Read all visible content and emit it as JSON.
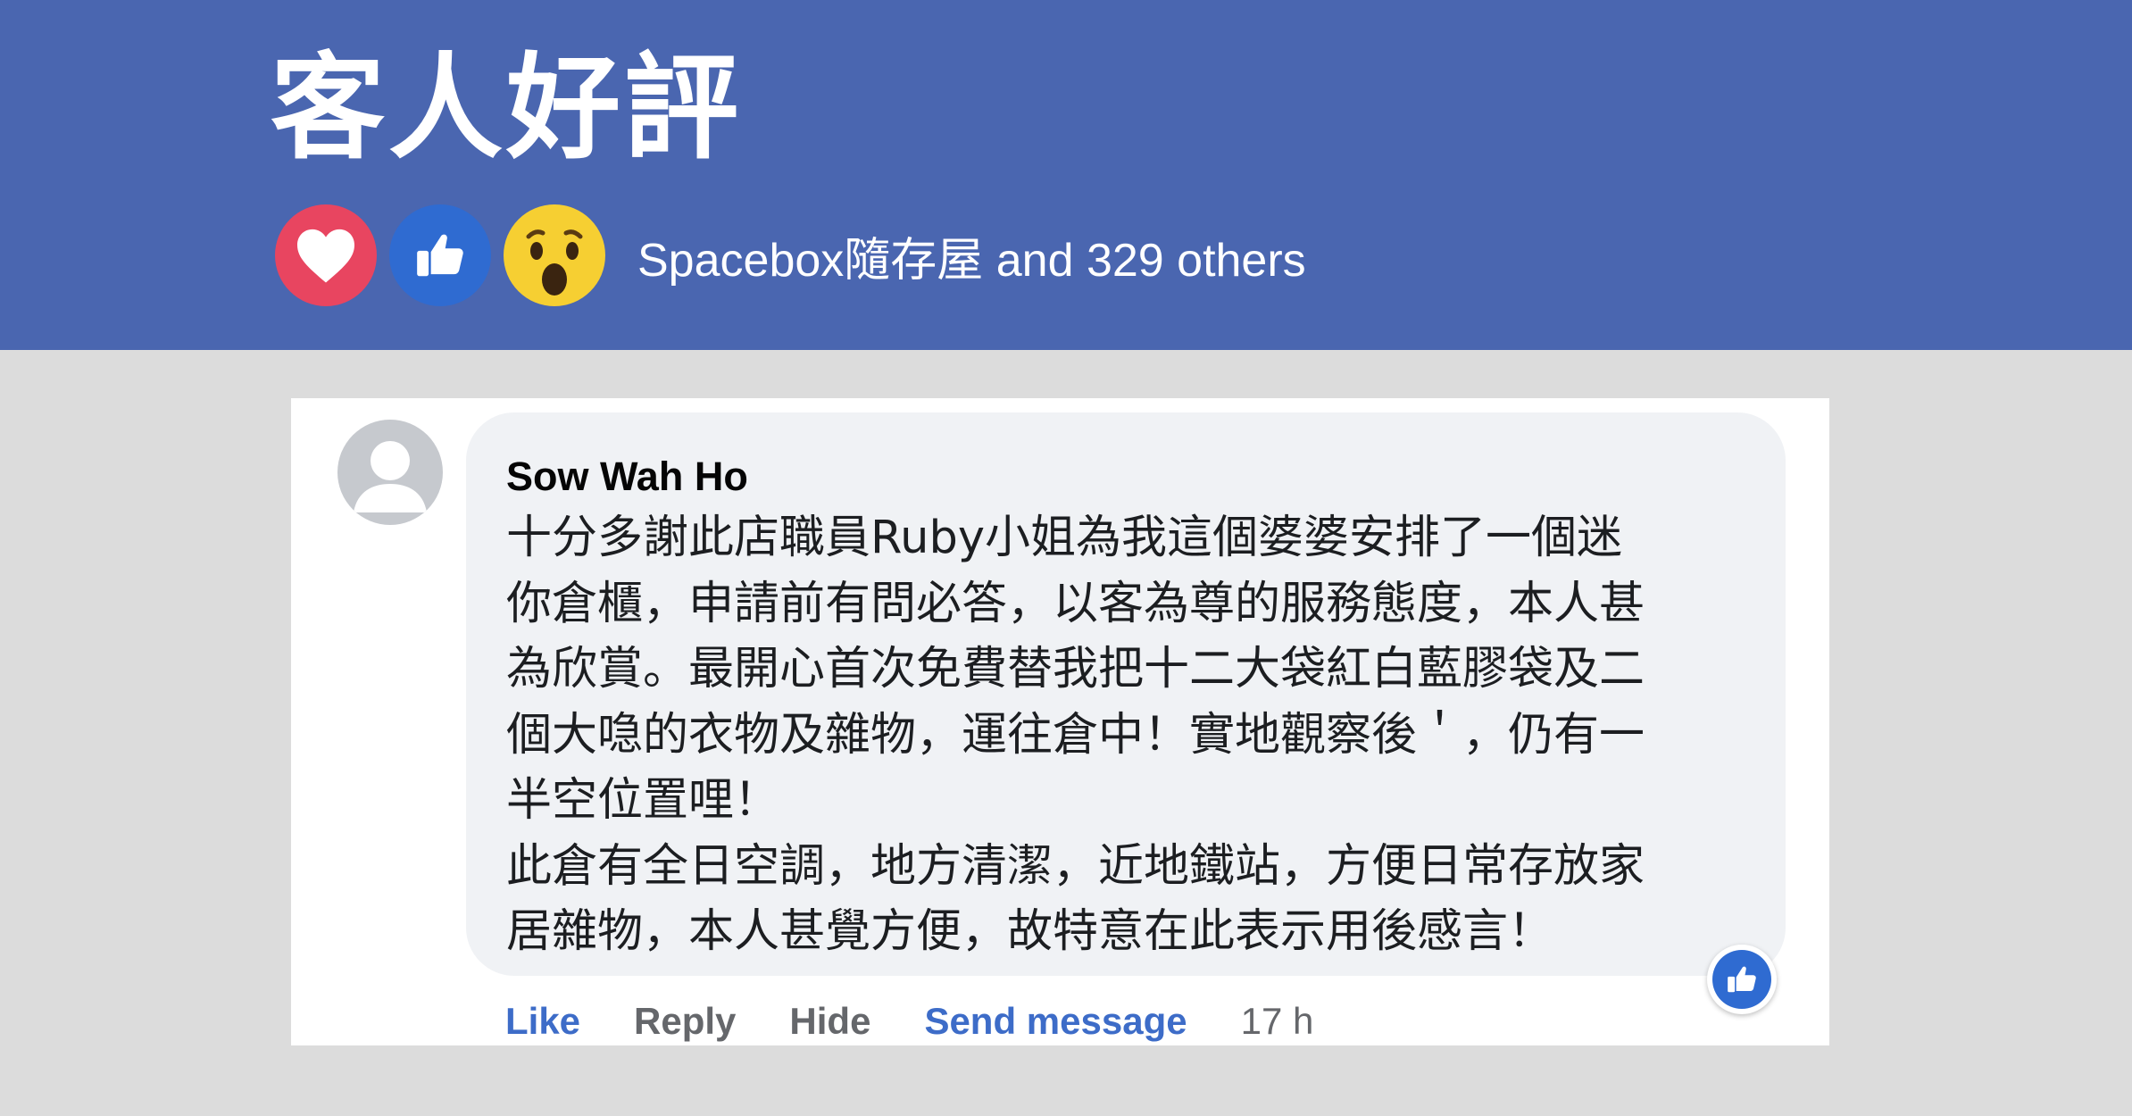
{
  "header": {
    "title": "客人好評",
    "reactions": {
      "icons": [
        "heart-icon",
        "thumbs-up-icon",
        "wow-face-icon"
      ],
      "summary": "Spacebox隨存屋 and  329 others"
    }
  },
  "comment": {
    "author": "Sow Wah Ho",
    "lines": [
      "十分多謝此店職員Ruby小姐為我這個婆婆安排了一個迷",
      "你倉櫃，申請前有問必答，以客為尊的服務態度，本人甚",
      "為欣賞。最開心首次免費替我把十二大袋紅白藍膠袋及二",
      "個大喼的衣物及雜物，運往倉中！實地觀察後＇，仍有一",
      "半空位置哩！",
      "此倉有全日空調，地方清潔，近地鐵站，方便日常存放家",
      "居雜物，本人甚覺方便，故特意在此表示用後感言！"
    ],
    "actions": {
      "like": "Like",
      "reply": "Reply",
      "hide": "Hide",
      "send_message": "Send message",
      "time": "17 h"
    }
  },
  "colors": {
    "header_bg": "#4a66b0",
    "page_bg": "#dcdcdc",
    "bubble_bg": "#f0f2f5",
    "link_blue": "#3d6cc8",
    "like_blue": "#2f6bd1",
    "love_red": "#e84560",
    "wow_yellow": "#f6cf32"
  }
}
